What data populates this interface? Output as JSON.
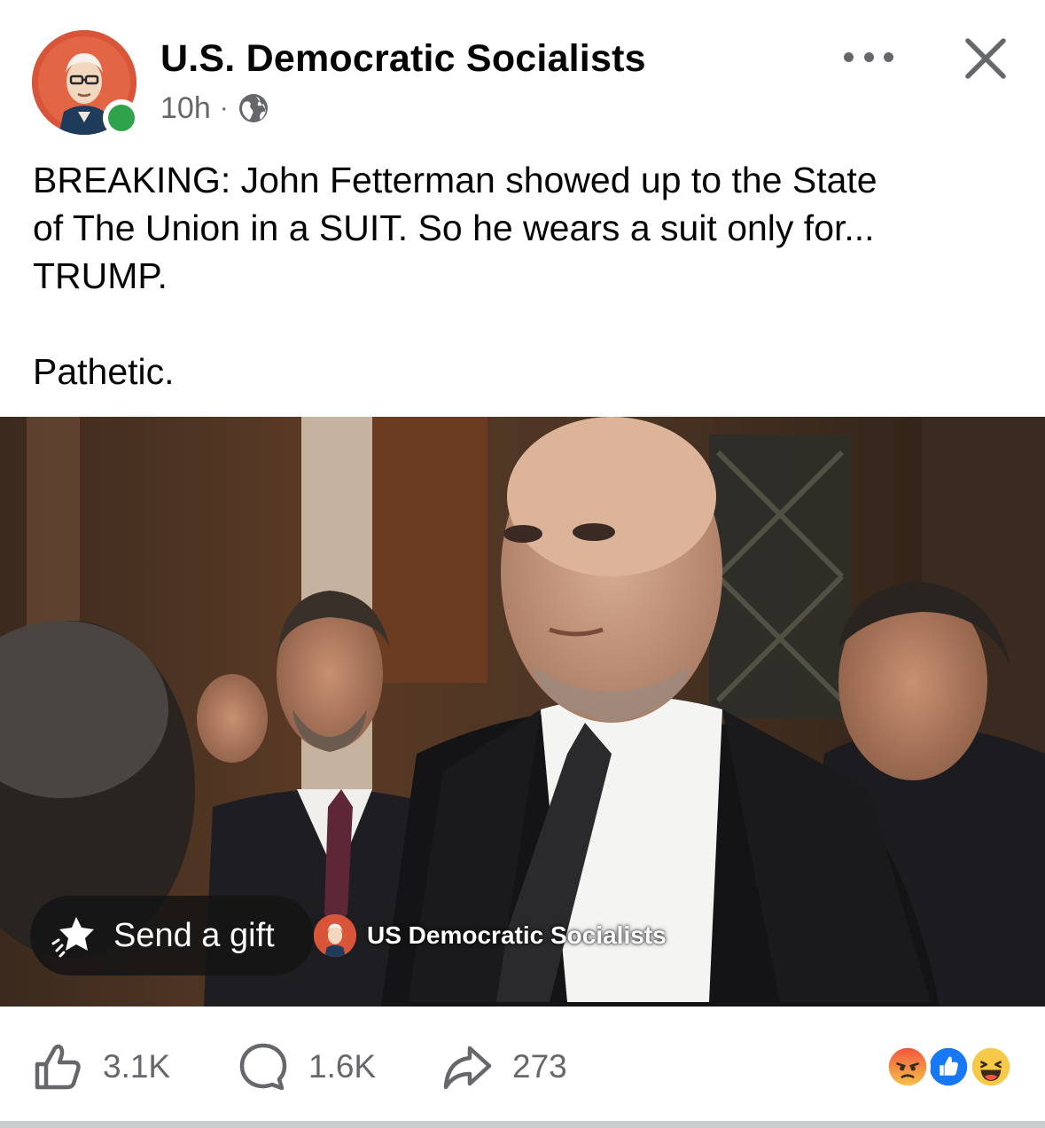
{
  "post": {
    "page_name": "U.S. Democratic Socialists",
    "time": "10h",
    "separator": "·",
    "privacy_icon": "globe-icon",
    "text_lines": [
      "BREAKING: John Fetterman showed up to the State",
      "of The Union in a SUIT. So he wears a suit only for...",
      "TRUMP."
    ],
    "text_last": "Pathetic."
  },
  "header": {
    "more_icon": "more-options-icon",
    "close_icon": "close-icon"
  },
  "media": {
    "gift_label": "Send a gift",
    "watermark": "US Democratic Socialists"
  },
  "actions": {
    "likes": "3.1K",
    "comments": "1.6K",
    "shares": "273",
    "reaction_icons": [
      "angry-icon",
      "like-icon",
      "haha-icon"
    ]
  },
  "colors": {
    "accent": "#1877f2",
    "secondary_text": "#65676b",
    "online": "#31a24c",
    "avatar_bg": "#d9553a"
  }
}
